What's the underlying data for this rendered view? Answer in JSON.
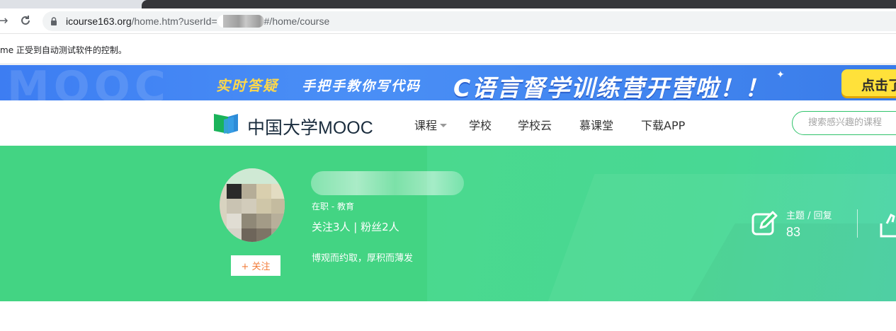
{
  "browser": {
    "address_domain": "icourse163.org",
    "address_path": "/home.htm?userId=",
    "address_suffix": "#/home/course",
    "automation_notice": "me 正受到自动测试软件的控制。"
  },
  "banner": {
    "ghost_text": "MOOC",
    "part1": "实时答疑",
    "part2": "手把手教你写代码",
    "headline": "C语言督学训练营开营啦！！",
    "cta_label": "点击了"
  },
  "header": {
    "logo_text": "中国大学MOOC",
    "nav": [
      {
        "label": "课程"
      },
      {
        "label": "学校"
      },
      {
        "label": "学校云"
      },
      {
        "label": "慕课堂"
      },
      {
        "label": "下载APP"
      }
    ],
    "search_placeholder": "搜索感兴趣的课程"
  },
  "profile": {
    "follow_label": "+ 关注",
    "job": "在职 - 教育",
    "follows": "关注3人 | 粉丝2人",
    "motto": "博观而约取，厚积而薄发",
    "stats": [
      {
        "label": "主题 / 回复",
        "value": "83",
        "icon": "edit-icon"
      }
    ]
  },
  "colors": {
    "hero_green": "#43d483",
    "brand_green": "#2fc36b",
    "banner_blue": "#3d7df2",
    "cta_yellow": "#ffe13a"
  }
}
